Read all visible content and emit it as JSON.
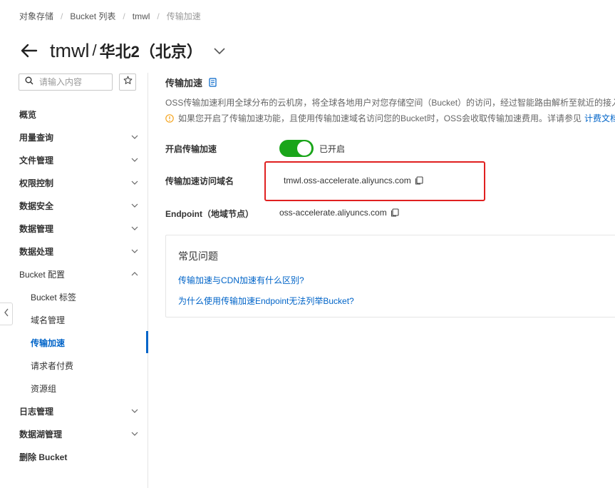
{
  "breadcrumb": {
    "items": [
      "对象存储",
      "Bucket 列表",
      "tmwl",
      "传输加速"
    ],
    "separator": "/"
  },
  "header": {
    "bucket_name": "tmwl",
    "separator": "/",
    "region": "华北2（北京）"
  },
  "search": {
    "placeholder": "请输入内容"
  },
  "sidebar": {
    "items": [
      {
        "label": "概览",
        "bold": true
      },
      {
        "label": "用量查询",
        "bold": true,
        "chevron": "down"
      },
      {
        "label": "文件管理",
        "bold": true,
        "chevron": "down"
      },
      {
        "label": "权限控制",
        "bold": true,
        "chevron": "down"
      },
      {
        "label": "数据安全",
        "bold": true,
        "chevron": "down"
      },
      {
        "label": "数据管理",
        "bold": true,
        "chevron": "down"
      },
      {
        "label": "数据处理",
        "bold": true,
        "chevron": "down"
      },
      {
        "label": "Bucket 配置",
        "bold": false,
        "chevron": "up"
      },
      {
        "label": "Bucket 标签",
        "sub": true
      },
      {
        "label": "域名管理",
        "sub": true
      },
      {
        "label": "传输加速",
        "sub": true,
        "active": true
      },
      {
        "label": "请求者付费",
        "sub": true
      },
      {
        "label": "资源组",
        "sub": true
      },
      {
        "label": "日志管理",
        "bold": true,
        "chevron": "down"
      },
      {
        "label": "数据湖管理",
        "bold": true,
        "chevron": "down"
      },
      {
        "label": "删除 Bucket",
        "bold": true
      }
    ]
  },
  "main": {
    "section_title": "传输加速",
    "description": "OSS传输加速利用全球分布的云机房，将全球各地用户对您存储空间（Bucket）的访问，经过智能路由解析至就近的接入点，使用优化后的网络及协议，为云存储互联网的上传、下载提供端到端的加速方案。",
    "notice": "如果您开启了传输加速功能，且使用传输加速域名访问您的Bucket时，OSS会收取传输加速费用。详请参见",
    "notice_link": "计费文档",
    "enable_label": "开启传输加速",
    "enable_status": "已开启",
    "enabled": true,
    "domain_label": "传输加速访问域名",
    "domain_value": "tmwl.oss-accelerate.aliyuncs.com",
    "endpoint_label": "Endpoint（地域节点）",
    "endpoint_value": "oss-accelerate.aliyuncs.com"
  },
  "faq": {
    "title": "常见问题",
    "links": [
      "传输加速与CDN加速有什么区别?",
      "为什么使用传输加速Endpoint无法列举Bucket?"
    ]
  },
  "colors": {
    "accent": "#0064c8",
    "toggle_on": "#1aa51a",
    "highlight": "#e02020"
  }
}
